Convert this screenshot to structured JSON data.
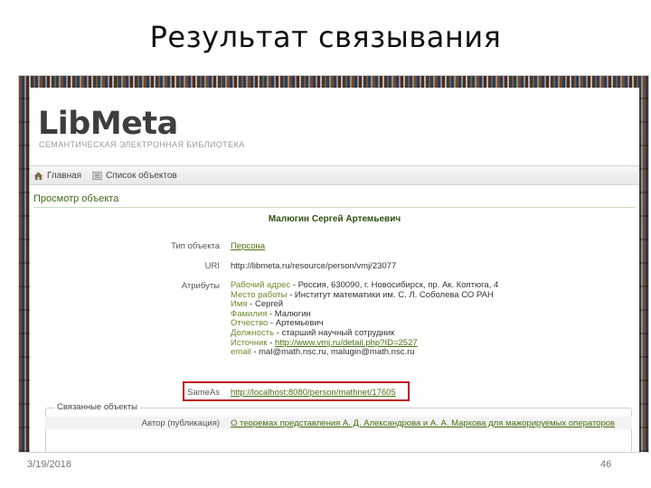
{
  "slide": {
    "title": "Результат связывания",
    "date": "3/19/2018",
    "page": "46"
  },
  "site": {
    "logo": "LibMeta",
    "subtitle": "СЕМАНТИЧЕСКАЯ ЭЛЕКТРОННАЯ БИБЛИОТЕКА",
    "nav": [
      {
        "label": "Главная",
        "icon": "home-icon"
      },
      {
        "label": "Список объектов",
        "icon": "list-icon"
      }
    ],
    "section_title": "Просмотр объекта",
    "person_name": "Малюгин Сергей Артемьевич",
    "fields": {
      "type_label": "Тип объекта",
      "type_value": "Персона",
      "uri_label": "URI",
      "uri_value": "http://libmeta.ru/resource/person/vmj/23077",
      "attrs_label": "Атрибуты",
      "sameas_label": "SameAs",
      "sameas_value": "http://localhost:8080/person/mathnet/17605"
    },
    "attributes": [
      {
        "key": "Рабочий адрес",
        "value": " - Россия, 630090, г. Новосибирск, пр. Ак. Коптюга, 4",
        "link": false
      },
      {
        "key": "Место работы",
        "value": " - Институт математики им. С. Л. Соболева СО РАН",
        "link": false
      },
      {
        "key": "Имя",
        "value": " - Сергей",
        "link": false
      },
      {
        "key": "Фамилия",
        "value": " - Малюгин",
        "link": false
      },
      {
        "key": "Отчество",
        "value": " - Артемьевич",
        "link": false
      },
      {
        "key": "Должность",
        "value": " - старший научный сотрудник",
        "link": false
      },
      {
        "key": "Источник",
        "value": "http://www.vmj.ru/detail.php?ID=2527",
        "link": true
      },
      {
        "key": "email",
        "value": " - mal@math.nsc.ru, malugin@math.nsc.ru",
        "link": false
      }
    ],
    "linked": {
      "legend": "Связанные объекты",
      "row_label": "Автор (публикация)",
      "row_value": "О теоремах представления А. Д. Александрова и А. А. Маркова для мажорируемых операторов"
    }
  },
  "colors": {
    "accent_green": "#4a6f10",
    "highlight_red": "#c0111b"
  }
}
